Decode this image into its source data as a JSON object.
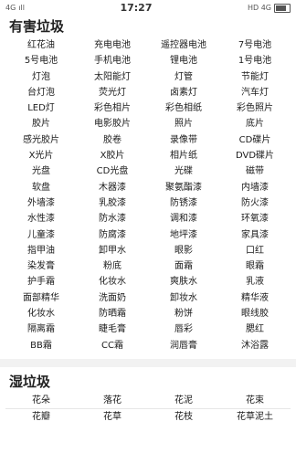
{
  "statusbar": {
    "network": "4G",
    "signal": "ıll",
    "time": "17:27",
    "right": "HD 4G"
  },
  "hazardous": {
    "title": "有害垃圾",
    "items": [
      "红花油",
      "充电电池",
      "遥控器电池",
      "7号电池",
      "5号电池",
      "手机电池",
      "锂电池",
      "1号电池",
      "灯泡",
      "太阳能灯",
      "灯管",
      "节能灯",
      "台灯泡",
      "荧光灯",
      "卤素灯",
      "汽车灯",
      "LED灯",
      "彩色相片",
      "彩色相纸",
      "彩色照片",
      "胶片",
      "电影胶片",
      "照片",
      "底片",
      "感光胶片",
      "胶卷",
      "录像带",
      "CD碟片",
      "X光片",
      "X胶片",
      "相片纸",
      "DVD碟片",
      "光盘",
      "CD光盘",
      "光碟",
      "磁带",
      "软盘",
      "木器漆",
      "聚氨酯漆",
      "内墙漆",
      "外墙漆",
      "乳胶漆",
      "防锈漆",
      "防火漆",
      "水性漆",
      "防水漆",
      "调和漆",
      "环氧漆",
      "儿童漆",
      "防腐漆",
      "地坪漆",
      "家具漆",
      "指甲油",
      "卸甲水",
      "眼影",
      "口红",
      "染发膏",
      "粉底",
      "面霜",
      "眼霜",
      "护手霜",
      "化妆水",
      "爽肤水",
      "乳液",
      "面部精华",
      "洗面奶",
      "卸妆水",
      "精华液",
      "化妆水",
      "防晒霜",
      "粉饼",
      "眼线胶",
      "隔离霜",
      "睫毛膏",
      "唇彩",
      "腮红",
      "BB霜",
      "CC霜",
      "润唇膏",
      "沐浴露"
    ]
  },
  "wet": {
    "title": "湿垃圾",
    "items": [
      "花朵",
      "落花",
      "花泥",
      "花束",
      "花瓣",
      "花草",
      "花枝",
      "花草泥土"
    ]
  }
}
